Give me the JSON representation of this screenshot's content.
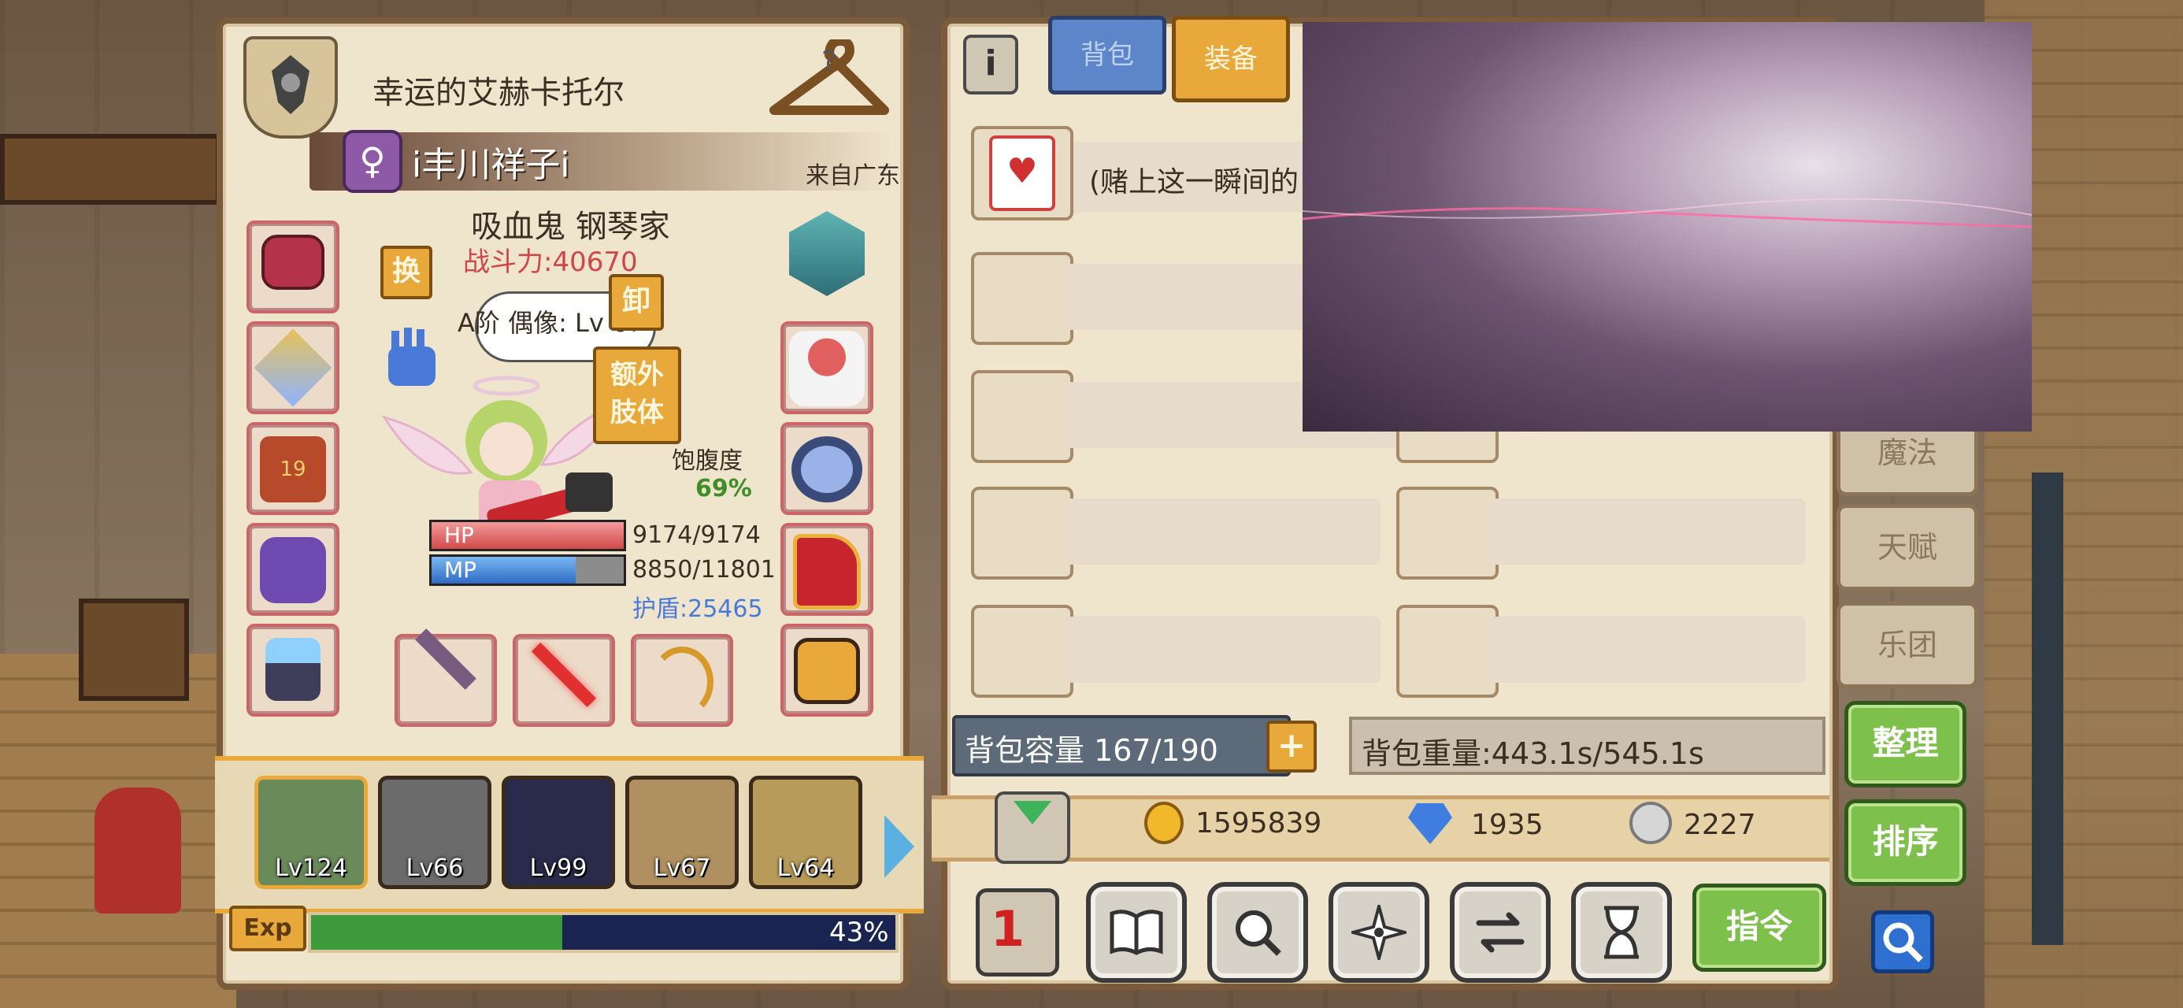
{
  "character": {
    "title": "幸运的艾赫卡托尔",
    "name": "i丰川祥子i",
    "origin": "来自广东",
    "race_class": "吸血鬼 钢琴家",
    "combat_power": "战斗力:40670",
    "switch_label": "换",
    "unequip_label": "卸",
    "extra_limb_label": "额外肢体",
    "idol_bubble": "A阶 偶像: Lv 67",
    "satiety_label": "饱腹度",
    "satiety_value": "69%",
    "hp_label": "HP",
    "hp_value": "9174/9174",
    "hp_fraction": 1.0,
    "mp_label": "MP",
    "mp_value": "8850/11801",
    "mp_fraction": 0.75,
    "shield": "护盾:25465",
    "exp_label": "Exp",
    "exp_percent": "43%",
    "exp_fraction": 0.43
  },
  "party": [
    {
      "level": "Lv124"
    },
    {
      "level": "Lv66"
    },
    {
      "level": "Lv99"
    },
    {
      "level": "Lv67"
    },
    {
      "level": "Lv64"
    }
  ],
  "inventory": {
    "tabs": [
      "背包",
      "装备"
    ],
    "active_tab": "装备",
    "first_item_text": "(赌上这一瞬间的",
    "capacity": "背包容量 167/190",
    "weight": "背包重量:443.1s/545.1s",
    "gold": "1595839",
    "gems": "1935",
    "silver": "2227"
  },
  "side_tabs": [
    "魔法",
    "天赋",
    "乐团"
  ],
  "buttons": {
    "organize": "整理",
    "sort": "排序",
    "command": "指令"
  },
  "colors": {
    "accent_gold": "#e9a93a",
    "combat_power": "#d0454a",
    "shield_blue": "#4a7ad9",
    "satiety_green": "#3f8e2a",
    "hp_red": "#e26a6a",
    "mp_blue": "#3f82d8",
    "exp_green": "#3c9a3a"
  }
}
